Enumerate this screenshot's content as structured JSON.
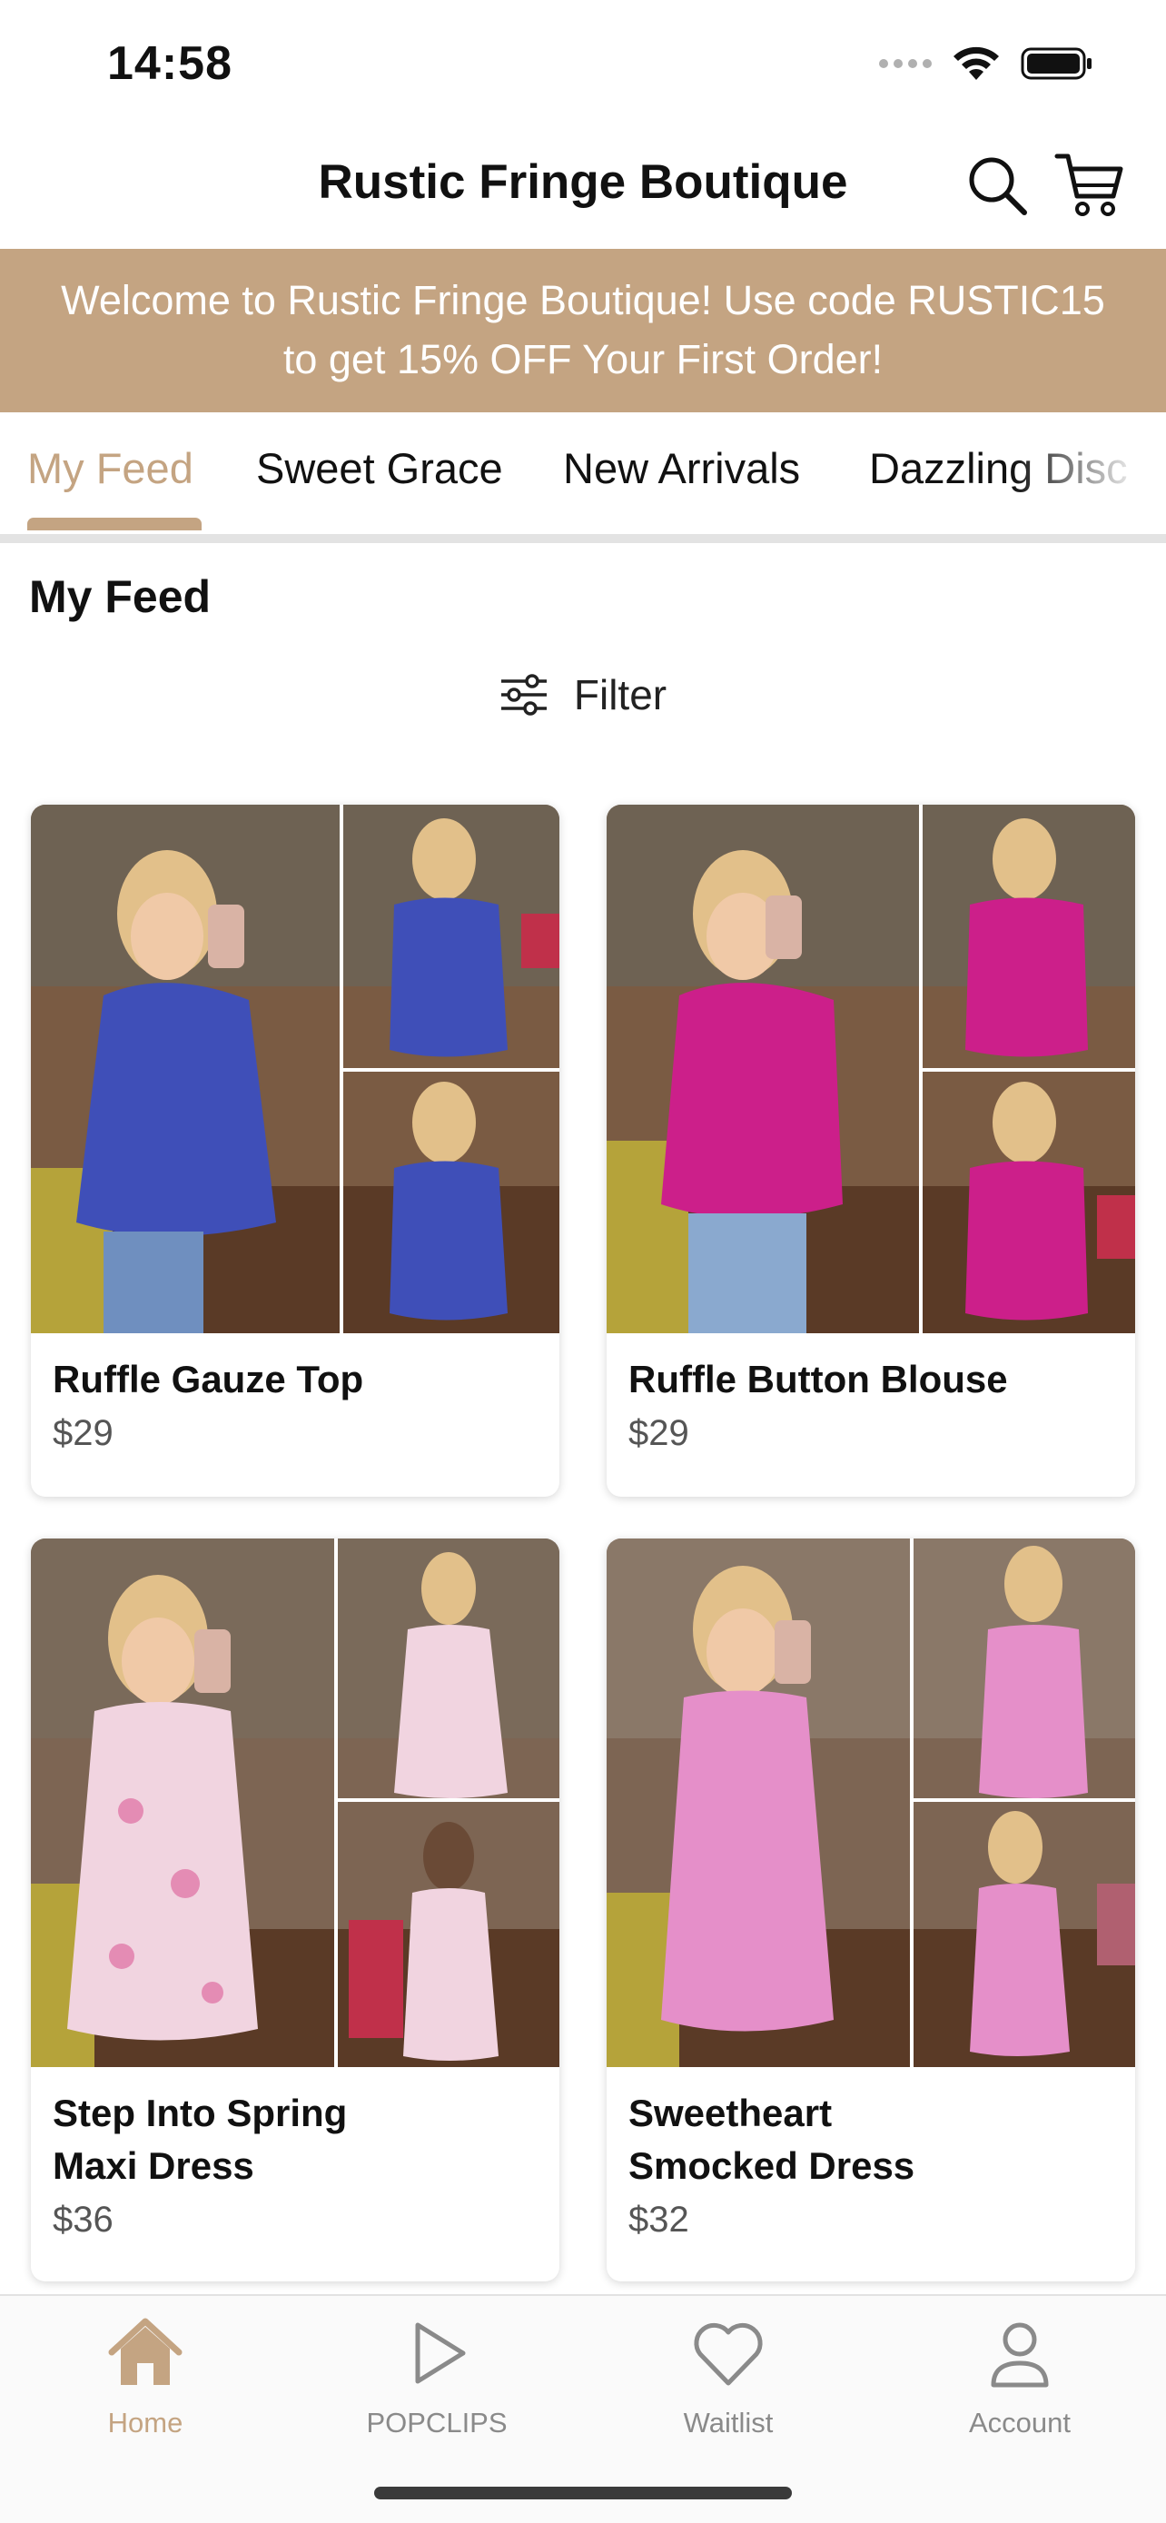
{
  "status_bar": {
    "time": "14:58"
  },
  "header": {
    "title": "Rustic Fringe Boutique",
    "search_icon": "search-icon",
    "cart_icon": "cart-icon"
  },
  "promo": {
    "line1": "Welcome to Rustic Fringe Boutique! Use code RUSTIC15",
    "line2": "to get 15% OFF Your First Order!"
  },
  "tabs": [
    {
      "label": "My Feed",
      "active": true
    },
    {
      "label": "Sweet Grace",
      "active": false
    },
    {
      "label": "New Arrivals",
      "active": false
    },
    {
      "label": "Dazzling Disc",
      "active": false
    }
  ],
  "feed": {
    "title": "My Feed",
    "filter_label": "Filter",
    "products": [
      {
        "name": "Ruffle Gauze Top",
        "price": "$29",
        "color": "#3f4fb8"
      },
      {
        "name": "Ruffle Button Blouse",
        "price": "$29",
        "color": "#cc1f8a"
      },
      {
        "name": "Step Into Spring Maxi Dress",
        "name_line1": "Step Into Spring",
        "name_line2": "Maxi Dress",
        "price": "$36",
        "color": "#f1d4e0"
      },
      {
        "name": "Sweetheart Smocked Dress",
        "name_line1": "Sweetheart",
        "name_line2": "Smocked Dress",
        "price": "$32",
        "color": "#e58fc9"
      }
    ]
  },
  "bottom_nav": [
    {
      "label": "Home",
      "icon": "home-icon",
      "active": true
    },
    {
      "label": "POPCLIPS",
      "icon": "play-icon",
      "active": false
    },
    {
      "label": "Waitlist",
      "icon": "heart-icon",
      "active": false
    },
    {
      "label": "Account",
      "icon": "person-icon",
      "active": false
    }
  ],
  "colors": {
    "accent": "#c4a482",
    "banner_text": "#ffffff",
    "inactive": "#8a8a8a"
  }
}
